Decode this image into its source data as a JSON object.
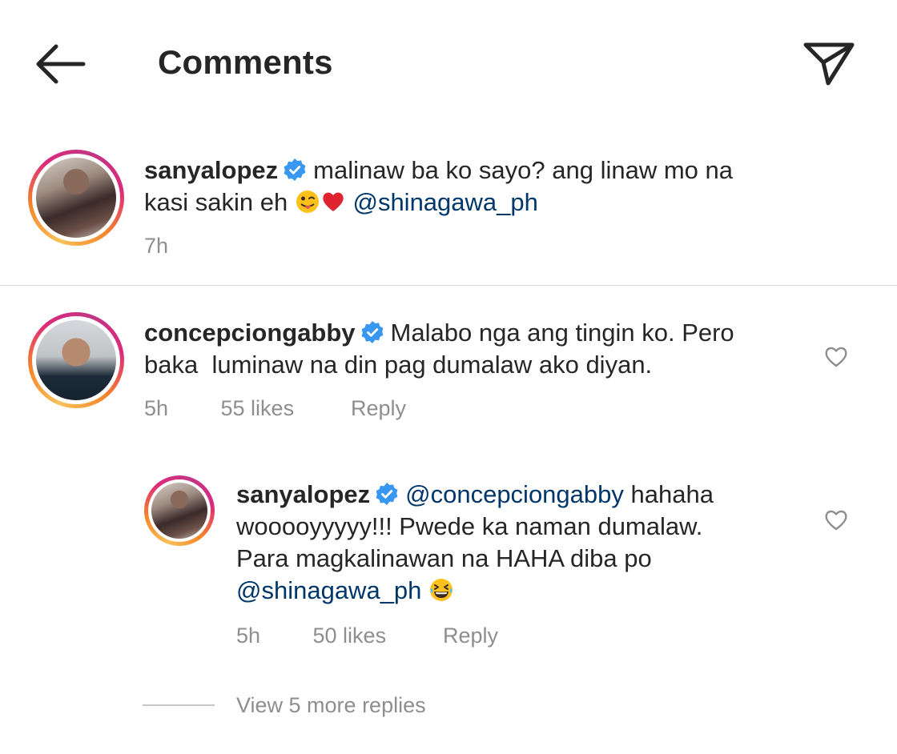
{
  "header": {
    "title": "Comments",
    "back_icon": "arrow-left-icon",
    "share_icon": "paper-plane-icon"
  },
  "caption": {
    "username": "sanyalopez",
    "text_1": "malinaw ba ko sayo? ang linaw mo na",
    "text_2": "kasi sakin eh",
    "emojis": [
      "winking-tongue-emoji",
      "red-heart-emoji"
    ],
    "mention": "@shinagawa_ph",
    "time": "7h"
  },
  "comments": [
    {
      "username": "concepciongabby",
      "text_1": "Malabo nga ang tingin ko. Pero",
      "text_2": "baka  luminaw na din pag dumalaw ako diyan.",
      "time": "5h",
      "likes": "55 likes",
      "reply": "Reply"
    }
  ],
  "replies": [
    {
      "username": "sanyalopez",
      "mention_1": "@concepciongabby",
      "text_1": "hahaha",
      "text_2": "wooooyyyyy!!! Pwede ka naman dumalaw.",
      "text_3": "Para magkalinawan na HAHA diba po",
      "mention_2": "@shinagawa_ph",
      "emoji": "grinning-squinting-emoji",
      "time": "5h",
      "likes": "50 likes",
      "reply": "Reply"
    }
  ],
  "view_more": "View 5 more replies",
  "colors": {
    "text": "#262626",
    "muted": "#8e8e8e",
    "mention": "#00376b",
    "verified": "#3897f0",
    "divider": "#dbdbdb"
  }
}
